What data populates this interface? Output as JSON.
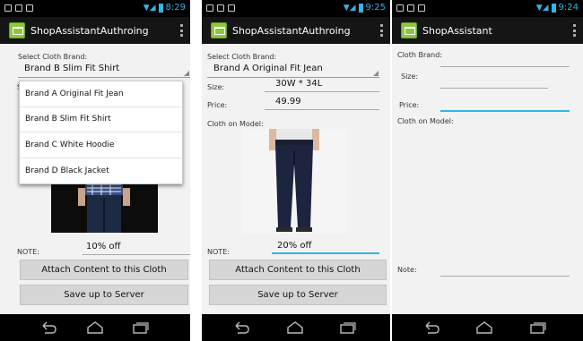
{
  "screens": [
    {
      "status_time": "8:29",
      "app_title": "ShopAssistantAuthroing",
      "select_label": "Select Cloth Brand:",
      "selected_brand": "Brand B Slim Fit Shirt",
      "dropdown_options": [
        "Brand A Original Fit Jean",
        "Brand B Slim Fit Shirt",
        "Brand C White Hoodie",
        "Brand D Black Jacket"
      ],
      "note_label": "NOTE:",
      "note_value": "10% off",
      "attach_button": "Attach Content to this Cloth",
      "save_button": "Save up to Server"
    },
    {
      "status_time": "9:25",
      "app_title": "ShopAssistantAuthroing",
      "select_label": "Select Cloth Brand:",
      "selected_brand": "Brand A Original Fit Jean",
      "size_label": "Size:",
      "size_value": "30W * 34L",
      "price_label": "Price:",
      "price_value": "49.99",
      "model_label": "Cloth on Model:",
      "note_label": "NOTE:",
      "note_value": "20% off",
      "attach_button": "Attach Content to this Cloth",
      "save_button": "Save up to Server"
    },
    {
      "status_time": "9:24",
      "app_title": "ShopAssistant",
      "brand_label": "Cloth Brand:",
      "size_label": "Size:",
      "price_label": "Price:",
      "model_label": "Cloth on Model:",
      "note_label": "Note:"
    }
  ],
  "colors": {
    "accent": "#33b5e5",
    "action_bar": "#151515",
    "app_icon": "#8dc63f",
    "button": "#d6d6d6",
    "background": "#f2f2f2"
  },
  "icons": [
    "wifi-icon",
    "battery-icon",
    "overflow-menu-icon",
    "back-icon",
    "home-icon",
    "recent-apps-icon",
    "app-icon"
  ]
}
